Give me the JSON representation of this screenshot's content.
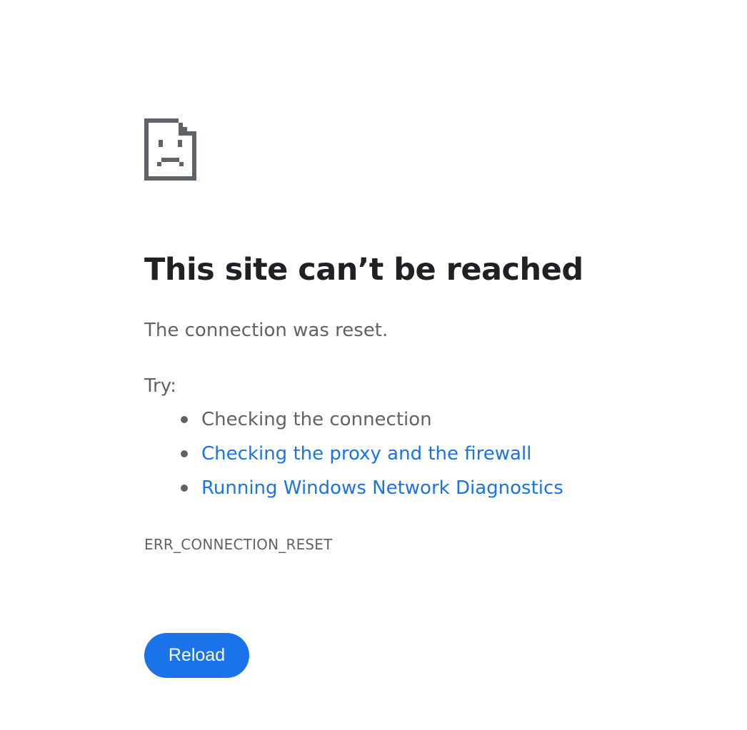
{
  "error_icon": "sad-page-icon",
  "title": "This site can’t be reached",
  "subtitle": "The connection was reset.",
  "try_label": "Try:",
  "suggestions": [
    {
      "text": "Checking the connection",
      "is_link": false
    },
    {
      "text": "Checking the proxy and the firewall",
      "is_link": true
    },
    {
      "text": "Running Windows Network Diagnostics",
      "is_link": true
    }
  ],
  "error_code": "ERR_CONNECTION_RESET",
  "reload_label": "Reload",
  "colors": {
    "title": "#202124",
    "body_text": "#5f6368",
    "link": "#1a73e8",
    "button_bg": "#1a73e8",
    "button_text": "#ffffff",
    "icon": "#5f6368"
  }
}
